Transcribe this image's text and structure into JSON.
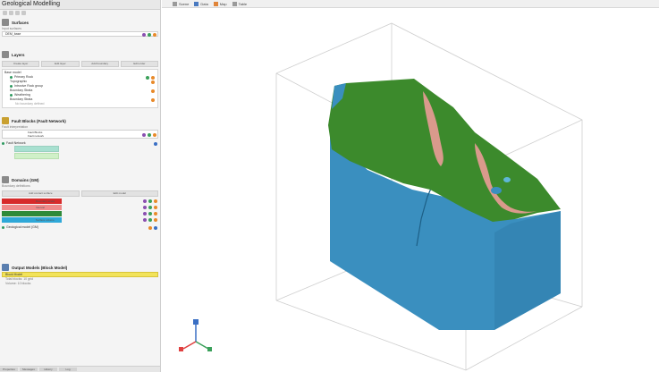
{
  "app": {
    "title": "Geological Modelling"
  },
  "toolbar": {
    "buttons": [
      "new-icon",
      "open-icon",
      "save-icon",
      "settings-icon"
    ]
  },
  "sections": {
    "surfaces": {
      "title": "Surfaces",
      "sublabel": "Input surfaces",
      "field_value": "DEM_base"
    },
    "layers": {
      "title": "Layers",
      "tabs": [
        "Create layer",
        "Edit layer",
        "Add boundary",
        "Edit order"
      ],
      "tree": [
        {
          "label": "Base model",
          "level": 0
        },
        {
          "label": "Primary Rock",
          "level": 1
        },
        {
          "label": "Topographic",
          "level": 1
        },
        {
          "label": "Intrusive Rock group",
          "level": 1
        },
        {
          "label": "Boundary Strata",
          "level": 1
        },
        {
          "label": "Weathering",
          "level": 1
        },
        {
          "label": "Boundary Strata",
          "level": 1
        },
        {
          "label": "No boundary defined",
          "level": 2
        }
      ]
    },
    "faults": {
      "title": "Fault Blocks (Fault Network)",
      "sublabel": "Fault interpretation",
      "rows": [
        {
          "label": "Fault Blocks"
        },
        {
          "label": "Fault network"
        }
      ],
      "block_label": "Fault Network",
      "swatches": [
        {
          "color": "#a8e0d0"
        },
        {
          "color": "#d0f0c8"
        }
      ]
    },
    "domains": {
      "title": "Domains (GM)",
      "sublabel": "Boundary definitions",
      "tabs": [
        "Add contact surface",
        "Edit model"
      ],
      "bars": [
        {
          "color": "#d72a2a",
          "label": "Boundary strata",
          "pct": 0.38
        },
        {
          "color": "#ef8a8a",
          "label": "Interval",
          "pct": 0.38
        },
        {
          "color": "#2e8a3a",
          "label": "",
          "pct": 0.38
        },
        {
          "color": "#2fa8d8",
          "label": "Surface volume",
          "pct": 0.38
        }
      ],
      "contact_label": "Geological model (GM)"
    },
    "output": {
      "title": "Output Models (Block Model)",
      "selected": "Block Model",
      "meta1": "Total blocks: 10 grid",
      "meta2": "Volume: 10 blocks"
    }
  },
  "bottom_tabs": [
    "Properties",
    "Messages",
    "History",
    "Log"
  ],
  "viewport": {
    "tabs": [
      {
        "label": "Scene",
        "icon": "scene-icon"
      },
      {
        "label": "Data",
        "icon": "data-icon"
      },
      {
        "label": "Map",
        "icon": "map-icon"
      },
      {
        "label": "Table",
        "icon": "table-icon"
      }
    ]
  },
  "colors": {
    "green_layer": "#3c8a2c",
    "blue_body": "#3a8fbf",
    "pink": "#d99a8c",
    "axis_x": "#e04040",
    "axis_y": "#3aa05a",
    "axis_z": "#3a6fc4"
  }
}
